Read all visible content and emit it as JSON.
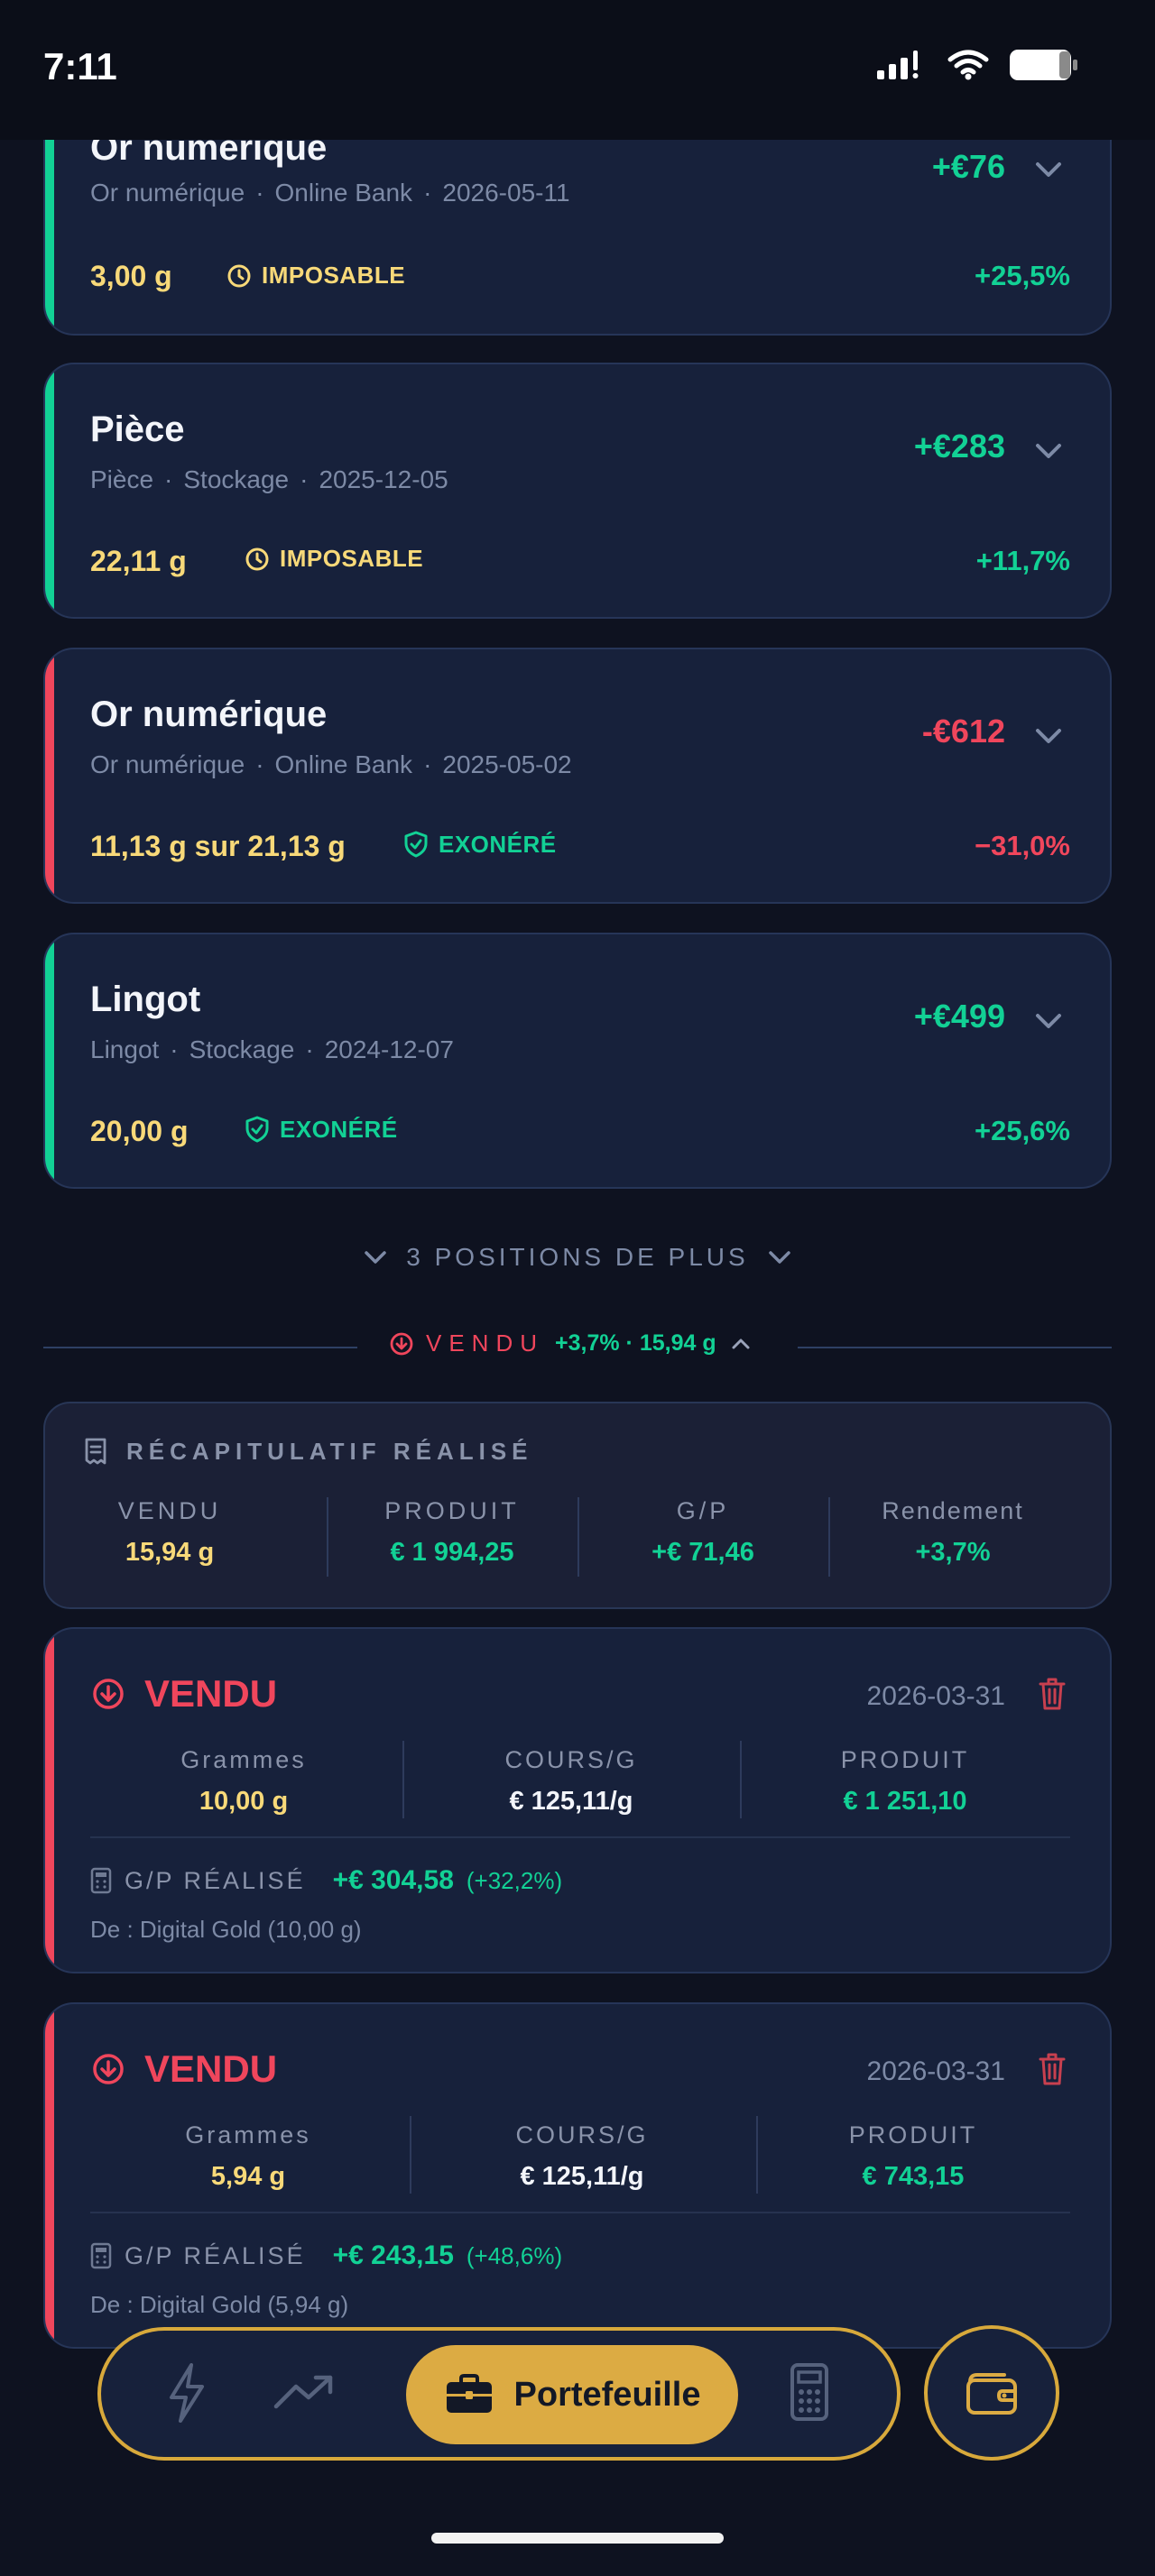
{
  "status": {
    "time": "7:11"
  },
  "positions": [
    {
      "name": "Or numérique",
      "type": "Or numérique",
      "place": "Online Bank",
      "date": "2026-05-11",
      "pl": "+€76",
      "grams": "3,00 g",
      "tax": "IMPOSABLE",
      "pct": "+25,5%"
    },
    {
      "name": "Pièce",
      "type": "Pièce",
      "place": "Stockage",
      "date": "2025-12-05",
      "pl": "+€283",
      "grams": "22,11 g",
      "tax": "IMPOSABLE",
      "pct": "+11,7%"
    },
    {
      "name": "Or numérique",
      "type": "Or numérique",
      "place": "Online Bank",
      "date": "2025-05-02",
      "pl": "-€612",
      "grams": "11,13 g sur 21,13 g",
      "tax": "EXONÉRÉ",
      "pct": "−31,0%"
    },
    {
      "name": "Lingot",
      "type": "Lingot",
      "place": "Stockage",
      "date": "2024-12-07",
      "pl": "+€499",
      "grams": "20,00 g",
      "tax": "EXONÉRÉ",
      "pct": "+25,6%"
    }
  ],
  "more_positions": "3 POSITIONS DE PLUS",
  "sold_divider": {
    "label": "VENDU",
    "summary": "+3,7% · 15,94 g"
  },
  "summary": {
    "title": "RÉCAPITULATIF RÉALISÉ",
    "cols": [
      {
        "label": "VENDU",
        "value": "15,94 g"
      },
      {
        "label": "PRODUIT",
        "value": "€ 1 994,25"
      },
      {
        "label": "G/P",
        "value": "+€ 71,46"
      },
      {
        "label": "Rendement",
        "value": "+3,7%"
      }
    ]
  },
  "sales": [
    {
      "title": "VENDU",
      "date": "2026-03-31",
      "grams_label": "Grammes",
      "grams": "10,00 g",
      "rate_label": "COURS/G",
      "rate": "€ 125,11/g",
      "proceeds_label": "PRODUIT",
      "proceeds": "€ 1 251,10",
      "gp_label": "G/P RÉALISÉ",
      "gp": "+€ 304,58",
      "gp_pct": "(+32,2%)",
      "from": "De : Digital Gold (10,00 g)"
    },
    {
      "title": "VENDU",
      "date": "2026-03-31",
      "grams_label": "Grammes",
      "grams": "5,94 g",
      "rate_label": "COURS/G",
      "rate": "€ 125,11/g",
      "proceeds_label": "PRODUIT",
      "proceeds": "€ 743,15",
      "gp_label": "G/P RÉALISÉ",
      "gp": "+€ 243,15",
      "gp_pct": "(+48,6%)",
      "from": "De : Digital Gold (5,94 g)"
    }
  ],
  "nav": {
    "active_label": "Portefeuille",
    "icons": [
      "bolt-icon",
      "trend-icon",
      "briefcase-icon",
      "calculator-icon",
      "wallet-icon"
    ]
  },
  "colors": {
    "accent": "#dcab43",
    "gain": "#12d195",
    "loss": "#f0465c",
    "grams": "#f8d979",
    "background": "#0e1220"
  }
}
